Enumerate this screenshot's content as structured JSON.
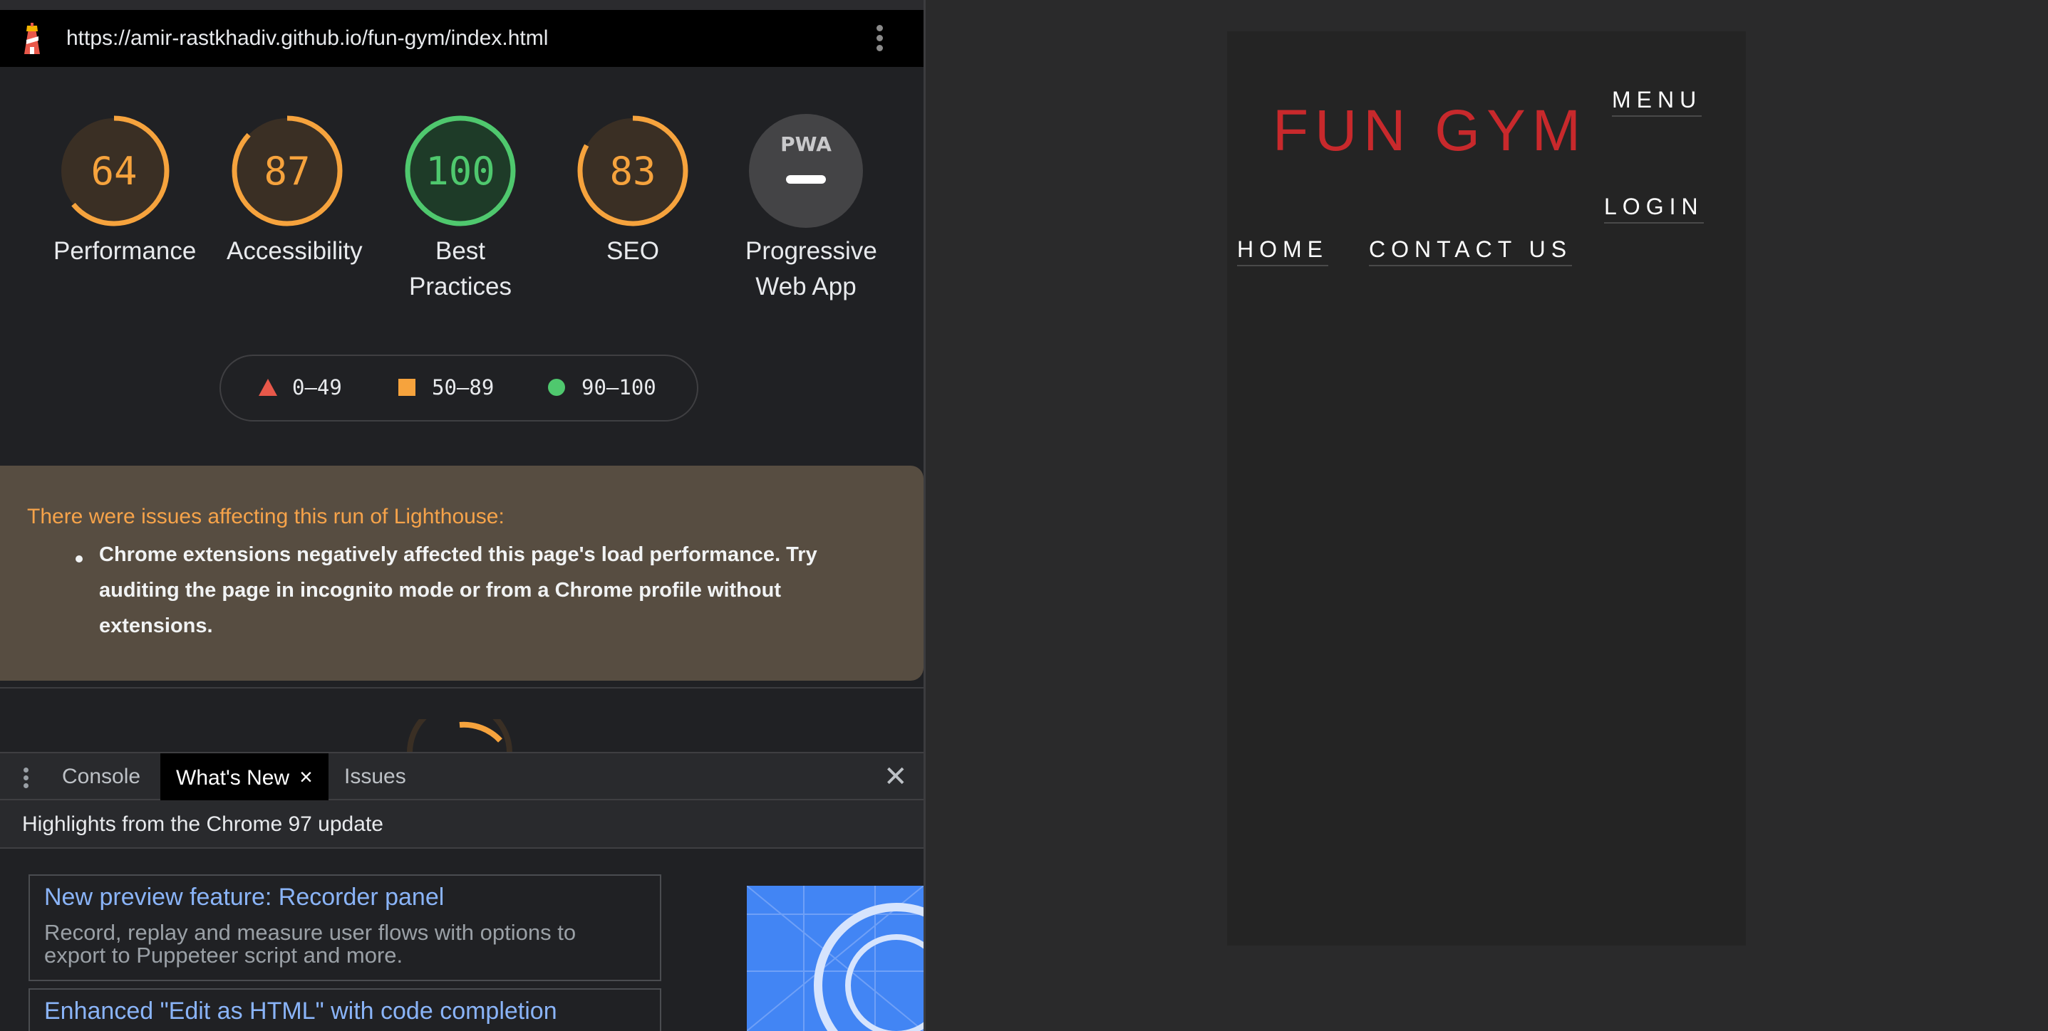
{
  "devtools": {
    "url": "https://amir-rastkhadiv.github.io/fun-gym/index.html",
    "gauges": [
      {
        "score": "64",
        "value": 64,
        "label_lines": [
          "Performance"
        ],
        "color": "#f6a33d"
      },
      {
        "score": "87",
        "value": 87,
        "label_lines": [
          "Accessibility"
        ],
        "color": "#f6a33d"
      },
      {
        "score": "100",
        "value": 100,
        "label_lines": [
          "Best",
          "Practices"
        ],
        "color": "#4fc86e"
      },
      {
        "score": "83",
        "value": 83,
        "label_lines": [
          "SEO"
        ],
        "color": "#f6a33d"
      }
    ],
    "pwa": {
      "badge": "PWA",
      "label_lines": [
        "Progressive",
        "Web App"
      ]
    },
    "legend": [
      {
        "shape": "triangle",
        "range": "0–49",
        "color": "#e8584a"
      },
      {
        "shape": "square",
        "range": "50–89",
        "color": "#f6a33d"
      },
      {
        "shape": "circle",
        "range": "90–100",
        "color": "#4fc86e"
      }
    ],
    "issues": {
      "title": "There were issues affecting this run of Lighthouse:",
      "items": [
        "Chrome extensions negatively affected this page's load performance. Try auditing the page in incognito mode or from a Chrome profile without extensions."
      ]
    },
    "drawer": {
      "tabs": [
        {
          "label": "Console",
          "active": false
        },
        {
          "label": "What's New",
          "active": true
        },
        {
          "label": "Issues",
          "active": false
        }
      ],
      "tab_close_glyph": "×",
      "close_glyph": "✕",
      "highlights": "Highlights from the Chrome 97 update",
      "cards": [
        {
          "title": "New preview feature: Recorder panel",
          "description": "Record, replay and measure user flows with options to export to Puppeteer script and more."
        },
        {
          "title": "Enhanced \"Edit as HTML\" with code completion",
          "description": ""
        }
      ]
    }
  },
  "site": {
    "logo": "FUN GYM",
    "menu": "MENU",
    "login": "LOGIN",
    "nav": [
      "HOME",
      "CONTACT US"
    ],
    "colors": {
      "logo": "#c8292c",
      "background": "#242424"
    }
  }
}
